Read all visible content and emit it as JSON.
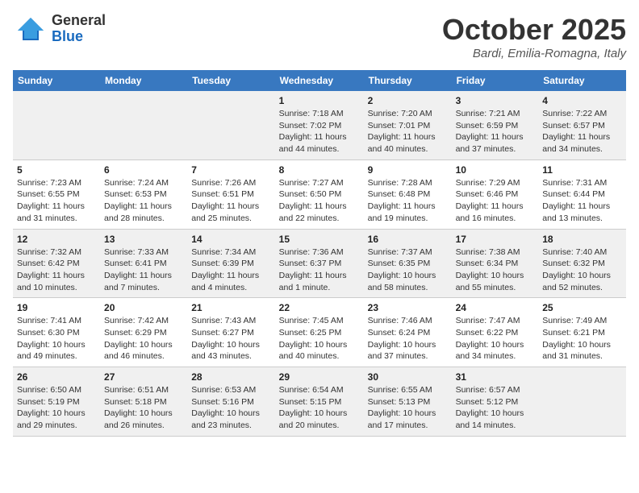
{
  "header": {
    "logo_general": "General",
    "logo_blue": "Blue",
    "month": "October 2025",
    "location": "Bardi, Emilia-Romagna, Italy"
  },
  "columns": [
    "Sunday",
    "Monday",
    "Tuesday",
    "Wednesday",
    "Thursday",
    "Friday",
    "Saturday"
  ],
  "weeks": [
    [
      {
        "day": "",
        "sunrise": "",
        "sunset": "",
        "daylight": ""
      },
      {
        "day": "",
        "sunrise": "",
        "sunset": "",
        "daylight": ""
      },
      {
        "day": "",
        "sunrise": "",
        "sunset": "",
        "daylight": ""
      },
      {
        "day": "1",
        "sunrise": "Sunrise: 7:18 AM",
        "sunset": "Sunset: 7:02 PM",
        "daylight": "Daylight: 11 hours and 44 minutes."
      },
      {
        "day": "2",
        "sunrise": "Sunrise: 7:20 AM",
        "sunset": "Sunset: 7:01 PM",
        "daylight": "Daylight: 11 hours and 40 minutes."
      },
      {
        "day": "3",
        "sunrise": "Sunrise: 7:21 AM",
        "sunset": "Sunset: 6:59 PM",
        "daylight": "Daylight: 11 hours and 37 minutes."
      },
      {
        "day": "4",
        "sunrise": "Sunrise: 7:22 AM",
        "sunset": "Sunset: 6:57 PM",
        "daylight": "Daylight: 11 hours and 34 minutes."
      }
    ],
    [
      {
        "day": "5",
        "sunrise": "Sunrise: 7:23 AM",
        "sunset": "Sunset: 6:55 PM",
        "daylight": "Daylight: 11 hours and 31 minutes."
      },
      {
        "day": "6",
        "sunrise": "Sunrise: 7:24 AM",
        "sunset": "Sunset: 6:53 PM",
        "daylight": "Daylight: 11 hours and 28 minutes."
      },
      {
        "day": "7",
        "sunrise": "Sunrise: 7:26 AM",
        "sunset": "Sunset: 6:51 PM",
        "daylight": "Daylight: 11 hours and 25 minutes."
      },
      {
        "day": "8",
        "sunrise": "Sunrise: 7:27 AM",
        "sunset": "Sunset: 6:50 PM",
        "daylight": "Daylight: 11 hours and 22 minutes."
      },
      {
        "day": "9",
        "sunrise": "Sunrise: 7:28 AM",
        "sunset": "Sunset: 6:48 PM",
        "daylight": "Daylight: 11 hours and 19 minutes."
      },
      {
        "day": "10",
        "sunrise": "Sunrise: 7:29 AM",
        "sunset": "Sunset: 6:46 PM",
        "daylight": "Daylight: 11 hours and 16 minutes."
      },
      {
        "day": "11",
        "sunrise": "Sunrise: 7:31 AM",
        "sunset": "Sunset: 6:44 PM",
        "daylight": "Daylight: 11 hours and 13 minutes."
      }
    ],
    [
      {
        "day": "12",
        "sunrise": "Sunrise: 7:32 AM",
        "sunset": "Sunset: 6:42 PM",
        "daylight": "Daylight: 11 hours and 10 minutes."
      },
      {
        "day": "13",
        "sunrise": "Sunrise: 7:33 AM",
        "sunset": "Sunset: 6:41 PM",
        "daylight": "Daylight: 11 hours and 7 minutes."
      },
      {
        "day": "14",
        "sunrise": "Sunrise: 7:34 AM",
        "sunset": "Sunset: 6:39 PM",
        "daylight": "Daylight: 11 hours and 4 minutes."
      },
      {
        "day": "15",
        "sunrise": "Sunrise: 7:36 AM",
        "sunset": "Sunset: 6:37 PM",
        "daylight": "Daylight: 11 hours and 1 minute."
      },
      {
        "day": "16",
        "sunrise": "Sunrise: 7:37 AM",
        "sunset": "Sunset: 6:35 PM",
        "daylight": "Daylight: 10 hours and 58 minutes."
      },
      {
        "day": "17",
        "sunrise": "Sunrise: 7:38 AM",
        "sunset": "Sunset: 6:34 PM",
        "daylight": "Daylight: 10 hours and 55 minutes."
      },
      {
        "day": "18",
        "sunrise": "Sunrise: 7:40 AM",
        "sunset": "Sunset: 6:32 PM",
        "daylight": "Daylight: 10 hours and 52 minutes."
      }
    ],
    [
      {
        "day": "19",
        "sunrise": "Sunrise: 7:41 AM",
        "sunset": "Sunset: 6:30 PM",
        "daylight": "Daylight: 10 hours and 49 minutes."
      },
      {
        "day": "20",
        "sunrise": "Sunrise: 7:42 AM",
        "sunset": "Sunset: 6:29 PM",
        "daylight": "Daylight: 10 hours and 46 minutes."
      },
      {
        "day": "21",
        "sunrise": "Sunrise: 7:43 AM",
        "sunset": "Sunset: 6:27 PM",
        "daylight": "Daylight: 10 hours and 43 minutes."
      },
      {
        "day": "22",
        "sunrise": "Sunrise: 7:45 AM",
        "sunset": "Sunset: 6:25 PM",
        "daylight": "Daylight: 10 hours and 40 minutes."
      },
      {
        "day": "23",
        "sunrise": "Sunrise: 7:46 AM",
        "sunset": "Sunset: 6:24 PM",
        "daylight": "Daylight: 10 hours and 37 minutes."
      },
      {
        "day": "24",
        "sunrise": "Sunrise: 7:47 AM",
        "sunset": "Sunset: 6:22 PM",
        "daylight": "Daylight: 10 hours and 34 minutes."
      },
      {
        "day": "25",
        "sunrise": "Sunrise: 7:49 AM",
        "sunset": "Sunset: 6:21 PM",
        "daylight": "Daylight: 10 hours and 31 minutes."
      }
    ],
    [
      {
        "day": "26",
        "sunrise": "Sunrise: 6:50 AM",
        "sunset": "Sunset: 5:19 PM",
        "daylight": "Daylight: 10 hours and 29 minutes."
      },
      {
        "day": "27",
        "sunrise": "Sunrise: 6:51 AM",
        "sunset": "Sunset: 5:18 PM",
        "daylight": "Daylight: 10 hours and 26 minutes."
      },
      {
        "day": "28",
        "sunrise": "Sunrise: 6:53 AM",
        "sunset": "Sunset: 5:16 PM",
        "daylight": "Daylight: 10 hours and 23 minutes."
      },
      {
        "day": "29",
        "sunrise": "Sunrise: 6:54 AM",
        "sunset": "Sunset: 5:15 PM",
        "daylight": "Daylight: 10 hours and 20 minutes."
      },
      {
        "day": "30",
        "sunrise": "Sunrise: 6:55 AM",
        "sunset": "Sunset: 5:13 PM",
        "daylight": "Daylight: 10 hours and 17 minutes."
      },
      {
        "day": "31",
        "sunrise": "Sunrise: 6:57 AM",
        "sunset": "Sunset: 5:12 PM",
        "daylight": "Daylight: 10 hours and 14 minutes."
      },
      {
        "day": "",
        "sunrise": "",
        "sunset": "",
        "daylight": ""
      }
    ]
  ]
}
